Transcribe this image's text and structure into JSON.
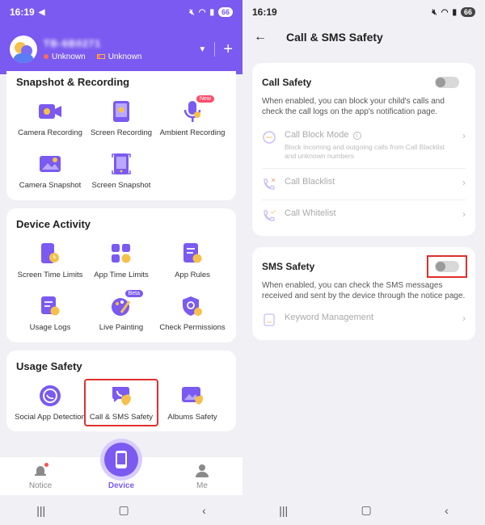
{
  "left": {
    "status": {
      "time": "16:19",
      "battery": "66"
    },
    "header": {
      "device_name": "TB-6B0271",
      "status1": "Unknown",
      "status2": "Unknown",
      "plus": "+"
    },
    "sections": [
      {
        "title": "Snapshot & Recording",
        "items": [
          {
            "label": "Camera Recording",
            "icon": "camera-recording-icon"
          },
          {
            "label": "Screen Recording",
            "icon": "screen-recording-icon"
          },
          {
            "label": "Ambient Recording",
            "icon": "microphone-icon",
            "badge": "New"
          },
          {
            "label": "Camera Snapshot",
            "icon": "camera-snapshot-icon"
          },
          {
            "label": "Screen Snapshot",
            "icon": "screen-snapshot-icon"
          }
        ]
      },
      {
        "title": "Device Activity",
        "items": [
          {
            "label": "Screen Time Limits",
            "icon": "screen-time-icon"
          },
          {
            "label": "App Time Limits",
            "icon": "app-time-icon"
          },
          {
            "label": "App Rules",
            "icon": "app-rules-icon"
          },
          {
            "label": "Usage Logs",
            "icon": "usage-logs-icon"
          },
          {
            "label": "Live Painting",
            "icon": "live-painting-icon",
            "badge": "Beta"
          },
          {
            "label": "Check Permissions",
            "icon": "check-permissions-icon"
          }
        ]
      },
      {
        "title": "Usage Safety",
        "items": [
          {
            "label": "Social App Detection",
            "icon": "social-app-icon"
          },
          {
            "label": "Call & SMS Safety",
            "icon": "call-sms-icon"
          },
          {
            "label": "Albums Safety",
            "icon": "albums-icon"
          }
        ]
      }
    ],
    "bottom_nav": {
      "notice": "Notice",
      "device": "Device",
      "me": "Me"
    }
  },
  "right": {
    "status": {
      "time": "16:19",
      "battery": "66"
    },
    "title": "Call & SMS Safety",
    "call_safety": {
      "title": "Call Safety",
      "toggle_on": false,
      "desc": "When enabled, you can block your child's calls and check the call logs on the app's notification page.",
      "options": [
        {
          "label": "Call Block Mode",
          "sub": "Block incoming and outgoing calls from Call Blacklist and unknown numbers",
          "icon": "call-block-icon"
        },
        {
          "label": "Call Blacklist",
          "icon": "call-blacklist-icon"
        },
        {
          "label": "Call Whitelist",
          "icon": "call-whitelist-icon"
        }
      ]
    },
    "sms_safety": {
      "title": "SMS Safety",
      "toggle_on": false,
      "desc": "When enabled, you can check the SMS messages received and sent by the device through the notice page.",
      "options": [
        {
          "label": "Keyword Management",
          "icon": "keyword-icon"
        }
      ]
    }
  },
  "colors": {
    "brand": "#7a5af0",
    "highlight": "#e0302b",
    "accent": "#f6c14a"
  }
}
